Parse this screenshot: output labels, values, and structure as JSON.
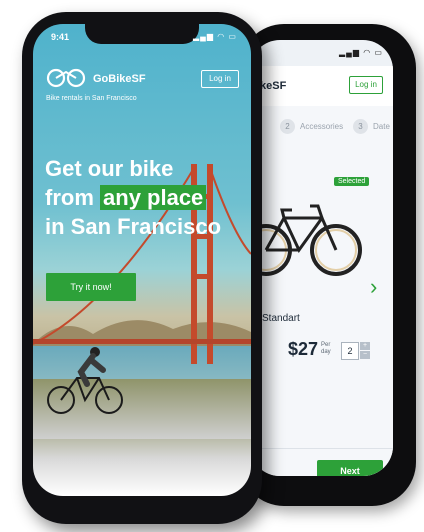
{
  "back_screen": {
    "status_time": "",
    "header": {
      "brand_partial": "keSF",
      "login_label": "Log in"
    },
    "steps": [
      {
        "num": "",
        "label": "s"
      },
      {
        "num": "2",
        "label": "Accessories"
      },
      {
        "num": "3",
        "label": "Date"
      }
    ],
    "product": {
      "selected_badge": "Selected",
      "name": "Standart",
      "price": "$27",
      "per_day": "Per day",
      "quantity": "2"
    },
    "next_label": "Next"
  },
  "front_screen": {
    "status_time": "9:41",
    "brand": "GoBikeSF",
    "tagline": "Bike rentals in San Francisco",
    "login_label": "Log in",
    "hero": {
      "line1": "Get our bike",
      "line2_prefix": "from",
      "line2_highlight": "any place",
      "line3": "in San Francisco"
    },
    "cta_label": "Try it now!"
  },
  "colors": {
    "accent": "#2da139",
    "dark_text": "#1d2a38",
    "phone_body": "#111114"
  }
}
